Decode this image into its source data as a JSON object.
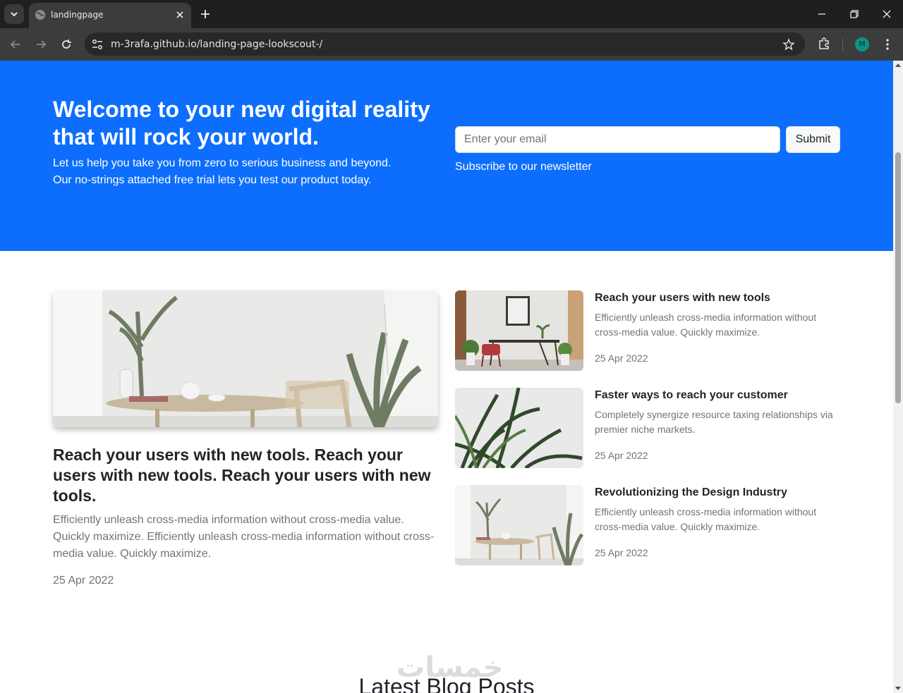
{
  "browser": {
    "tab_title": "landingpage",
    "url_host": "m-3rafa.github.io",
    "url_path": "/landing-page-lookscout-/",
    "avatar_letter": "M"
  },
  "hero": {
    "title": "Welcome to your new digital reality that will rock your world.",
    "text_line1": "Let us help you take you from zero to serious business and beyond.",
    "text_line2": "Our no-strings attached free trial lets you test our product today.",
    "email_placeholder": "Enter your email",
    "submit_label": "Submit",
    "newsletter": "Subscribe to our newsletter"
  },
  "featured": {
    "title": "Reach your users with new tools. Reach your users with new tools. Reach your users with new tools.",
    "text": "Efficiently unleash cross-media information without cross-media value. Quickly maximize. Efficiently unleash cross-media information without cross-media value. Quickly maximize.",
    "date": "25 Apr 2022"
  },
  "side_posts": [
    {
      "title": "Reach your users with new tools",
      "text": "Efficiently unleash cross-media information without cross-media value. Quickly maximize.",
      "date": "25 Apr 2022"
    },
    {
      "title": "Faster ways to reach your customer",
      "text": "Completely synergize resource taxing relationships via premier niche markets.",
      "date": "25 Apr 2022"
    },
    {
      "title": "Revolutionizing the Design Industry",
      "text": "Efficiently unleash cross-media information without cross-media value. Quickly maximize.",
      "date": "25 Apr 2022"
    }
  ],
  "watermark": "خمسات",
  "section_title": "Latest Blog Posts",
  "colors": {
    "hero_blue": "#0d6efd",
    "text_dark": "#212529",
    "text_muted": "#6c757d"
  }
}
